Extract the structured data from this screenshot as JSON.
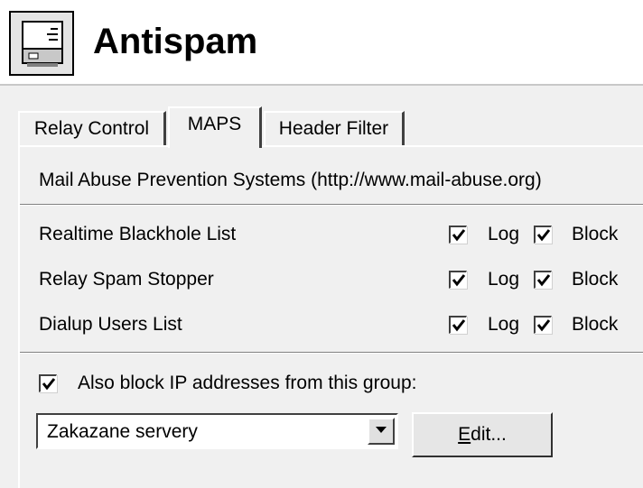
{
  "header": {
    "title": "Antispam",
    "icon": "server-settings-icon"
  },
  "tabs": [
    {
      "label": "Relay Control",
      "active": false
    },
    {
      "label": "MAPS",
      "active": true
    },
    {
      "label": "Header Filter",
      "active": false
    }
  ],
  "maps": {
    "heading": "Mail Abuse Prevention Systems (http://www.mail-abuse.org)",
    "rows": [
      {
        "label": "Realtime Blackhole List",
        "log_label": "Log",
        "log_checked": true,
        "block_label": "Block",
        "block_checked": true
      },
      {
        "label": "Relay Spam Stopper",
        "log_label": "Log",
        "log_checked": true,
        "block_label": "Block",
        "block_checked": true
      },
      {
        "label": "Dialup Users List",
        "log_label": "Log",
        "log_checked": true,
        "block_label": "Block",
        "block_checked": true
      }
    ],
    "also_block_label": "Also block IP addresses from this group:",
    "also_block_checked": true,
    "group_select": {
      "value": "Zakazane servery"
    },
    "edit_button": {
      "label": "Edit...",
      "mnemonic": "E",
      "rest": "dit..."
    }
  }
}
